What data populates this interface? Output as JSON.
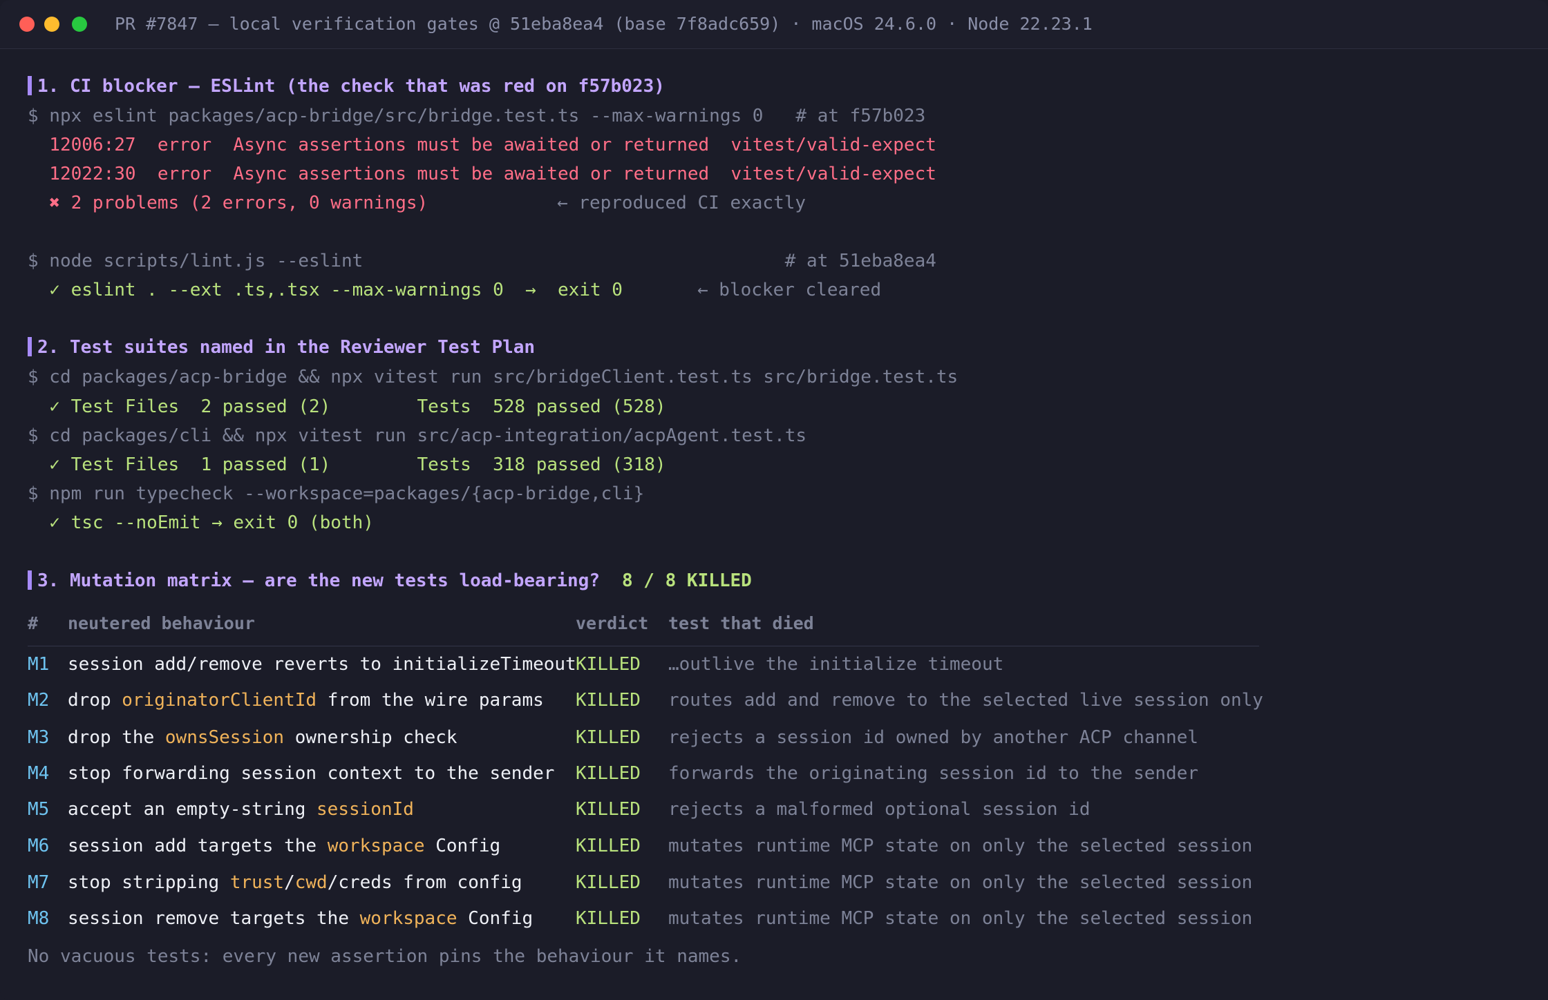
{
  "window": {
    "title": "PR #7847 — local verification gates @ 51eba8ea4 (base 7f8adc659) · macOS 24.6.0 · Node 22.23.1"
  },
  "section1": {
    "heading": "1. CI blocker — ESLint (the check that was red on f57b023)",
    "cmd1": "$ npx eslint packages/acp-bridge/src/bridge.test.ts --max-warnings 0   # at f57b023",
    "error1": "  12006:27  error  Async assertions must be awaited or returned  vitest/valid-expect",
    "error2": "  12022:30  error  Async assertions must be awaited or returned  vitest/valid-expect",
    "problems": "  ✖ 2 problems (2 errors, 0 warnings)",
    "problems_note": "← reproduced CI exactly",
    "cmd2": "$ node scripts/lint.js --eslint                                       # at 51eba8ea4",
    "result": "  ✓ eslint . --ext .ts,.tsx --max-warnings 0  →  exit 0",
    "result_note": "← blocker cleared"
  },
  "section2": {
    "heading": "2. Test suites named in the Reviewer Test Plan",
    "cmd1": "$ cd packages/acp-bridge && npx vitest run src/bridgeClient.test.ts src/bridge.test.ts",
    "res1": "  ✓ Test Files  2 passed (2)        Tests  528 passed (528)",
    "cmd2": "$ cd packages/cli && npx vitest run src/acp-integration/acpAgent.test.ts",
    "res2": "  ✓ Test Files  1 passed (1)        Tests  318 passed (318)",
    "cmd3": "$ npm run typecheck --workspace=packages/{acp-bridge,cli}",
    "res3": "  ✓ tsc --noEmit → exit 0 (both)"
  },
  "section3": {
    "heading": "3. Mutation matrix — are the new tests load-bearing?",
    "kill_summary": "8 / 8 KILLED",
    "columns": {
      "num": "#",
      "behaviour": "neutered behaviour",
      "verdict": "verdict",
      "died": "test that died"
    },
    "rows": [
      {
        "id": "M1",
        "pre": "session add/remove reverts to initializeTimeout",
        "hl": "",
        "post": "",
        "verdict": "KILLED",
        "died": "…outlive the initialize timeout"
      },
      {
        "id": "M2",
        "pre": "drop ",
        "hl": "originatorClientId",
        "post": " from the wire params",
        "verdict": "KILLED",
        "died": "routes add and remove to the selected live session only"
      },
      {
        "id": "M3",
        "pre": "drop the ",
        "hl": "ownsSession",
        "post": " ownership check",
        "verdict": "KILLED",
        "died": "rejects a session id owned by another ACP channel"
      },
      {
        "id": "M4",
        "pre": "stop forwarding session context to the sender",
        "hl": "",
        "post": "",
        "verdict": "KILLED",
        "died": "forwards the originating session id to the sender"
      },
      {
        "id": "M5",
        "pre": "accept an empty-string ",
        "hl": "sessionId",
        "post": "",
        "verdict": "KILLED",
        "died": "rejects a malformed optional session id"
      },
      {
        "id": "M6",
        "pre": "session add targets the ",
        "hl": "workspace",
        "post": " Config",
        "verdict": "KILLED",
        "died": "mutates runtime MCP state on only the selected session"
      },
      {
        "id": "M7",
        "pre": "stop stripping ",
        "hl": "trust",
        "mid": "/",
        "hl2": "cwd",
        "post": "/creds from config",
        "verdict": "KILLED",
        "died": "mutates runtime MCP state on only the selected session"
      },
      {
        "id": "M8",
        "pre": "session remove targets the ",
        "hl": "workspace",
        "post": " Config",
        "verdict": "KILLED",
        "died": "mutates runtime MCP state on only the selected session"
      }
    ],
    "footer": "No vacuous tests: every new assertion pins the behaviour it names."
  },
  "colors": {
    "background": "#1b1c28",
    "heading": "#c3a6ff",
    "error": "#ff6e87",
    "success": "#b9e27d",
    "muted": "#7d8297",
    "id": "#6ec3f0",
    "identifier": "#f0b35a"
  }
}
